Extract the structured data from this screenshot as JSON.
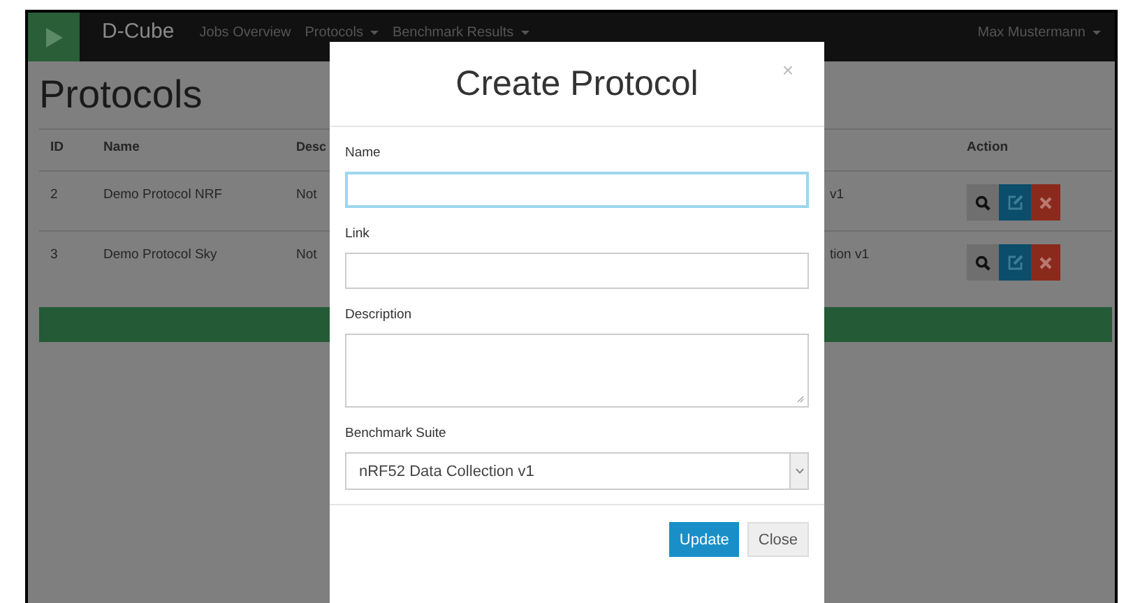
{
  "navbar": {
    "brand": "D-Cube",
    "links": [
      {
        "label": "Jobs Overview",
        "dropdown": false
      },
      {
        "label": "Protocols",
        "dropdown": true
      },
      {
        "label": "Benchmark Results",
        "dropdown": true
      }
    ],
    "user": {
      "label": "Max Mustermann",
      "dropdown": true
    }
  },
  "page": {
    "title": "Protocols"
  },
  "table": {
    "columns": [
      "ID",
      "Name",
      "Desc",
      "Action"
    ],
    "rows": [
      {
        "id": "2",
        "name": "Demo Protocol NRF",
        "description": "Not",
        "column_4": "v1",
        "actions": [
          {
            "kind": "search"
          },
          {
            "kind": "edit"
          },
          {
            "kind": "delete"
          }
        ]
      },
      {
        "id": "3",
        "name": "Demo Protocol Sky",
        "description": "Not",
        "column_4": "tion v1",
        "actions": [
          {
            "kind": "search"
          },
          {
            "kind": "edit"
          },
          {
            "kind": "delete"
          }
        ]
      }
    ]
  },
  "modal": {
    "title": "Create Protocol",
    "close": "×",
    "fields": [
      {
        "label": "Name",
        "kind": "input",
        "focused": true
      },
      {
        "label": "Link",
        "kind": "input",
        "focused": false
      },
      {
        "label": "Description",
        "kind": "textarea"
      },
      {
        "label": "Benchmark Suite",
        "kind": "select",
        "value": "nRF52 Data Collection v1"
      }
    ],
    "buttons": [
      {
        "label": "Update",
        "kind": "primary"
      },
      {
        "label": "Close",
        "kind": "default"
      }
    ]
  }
}
